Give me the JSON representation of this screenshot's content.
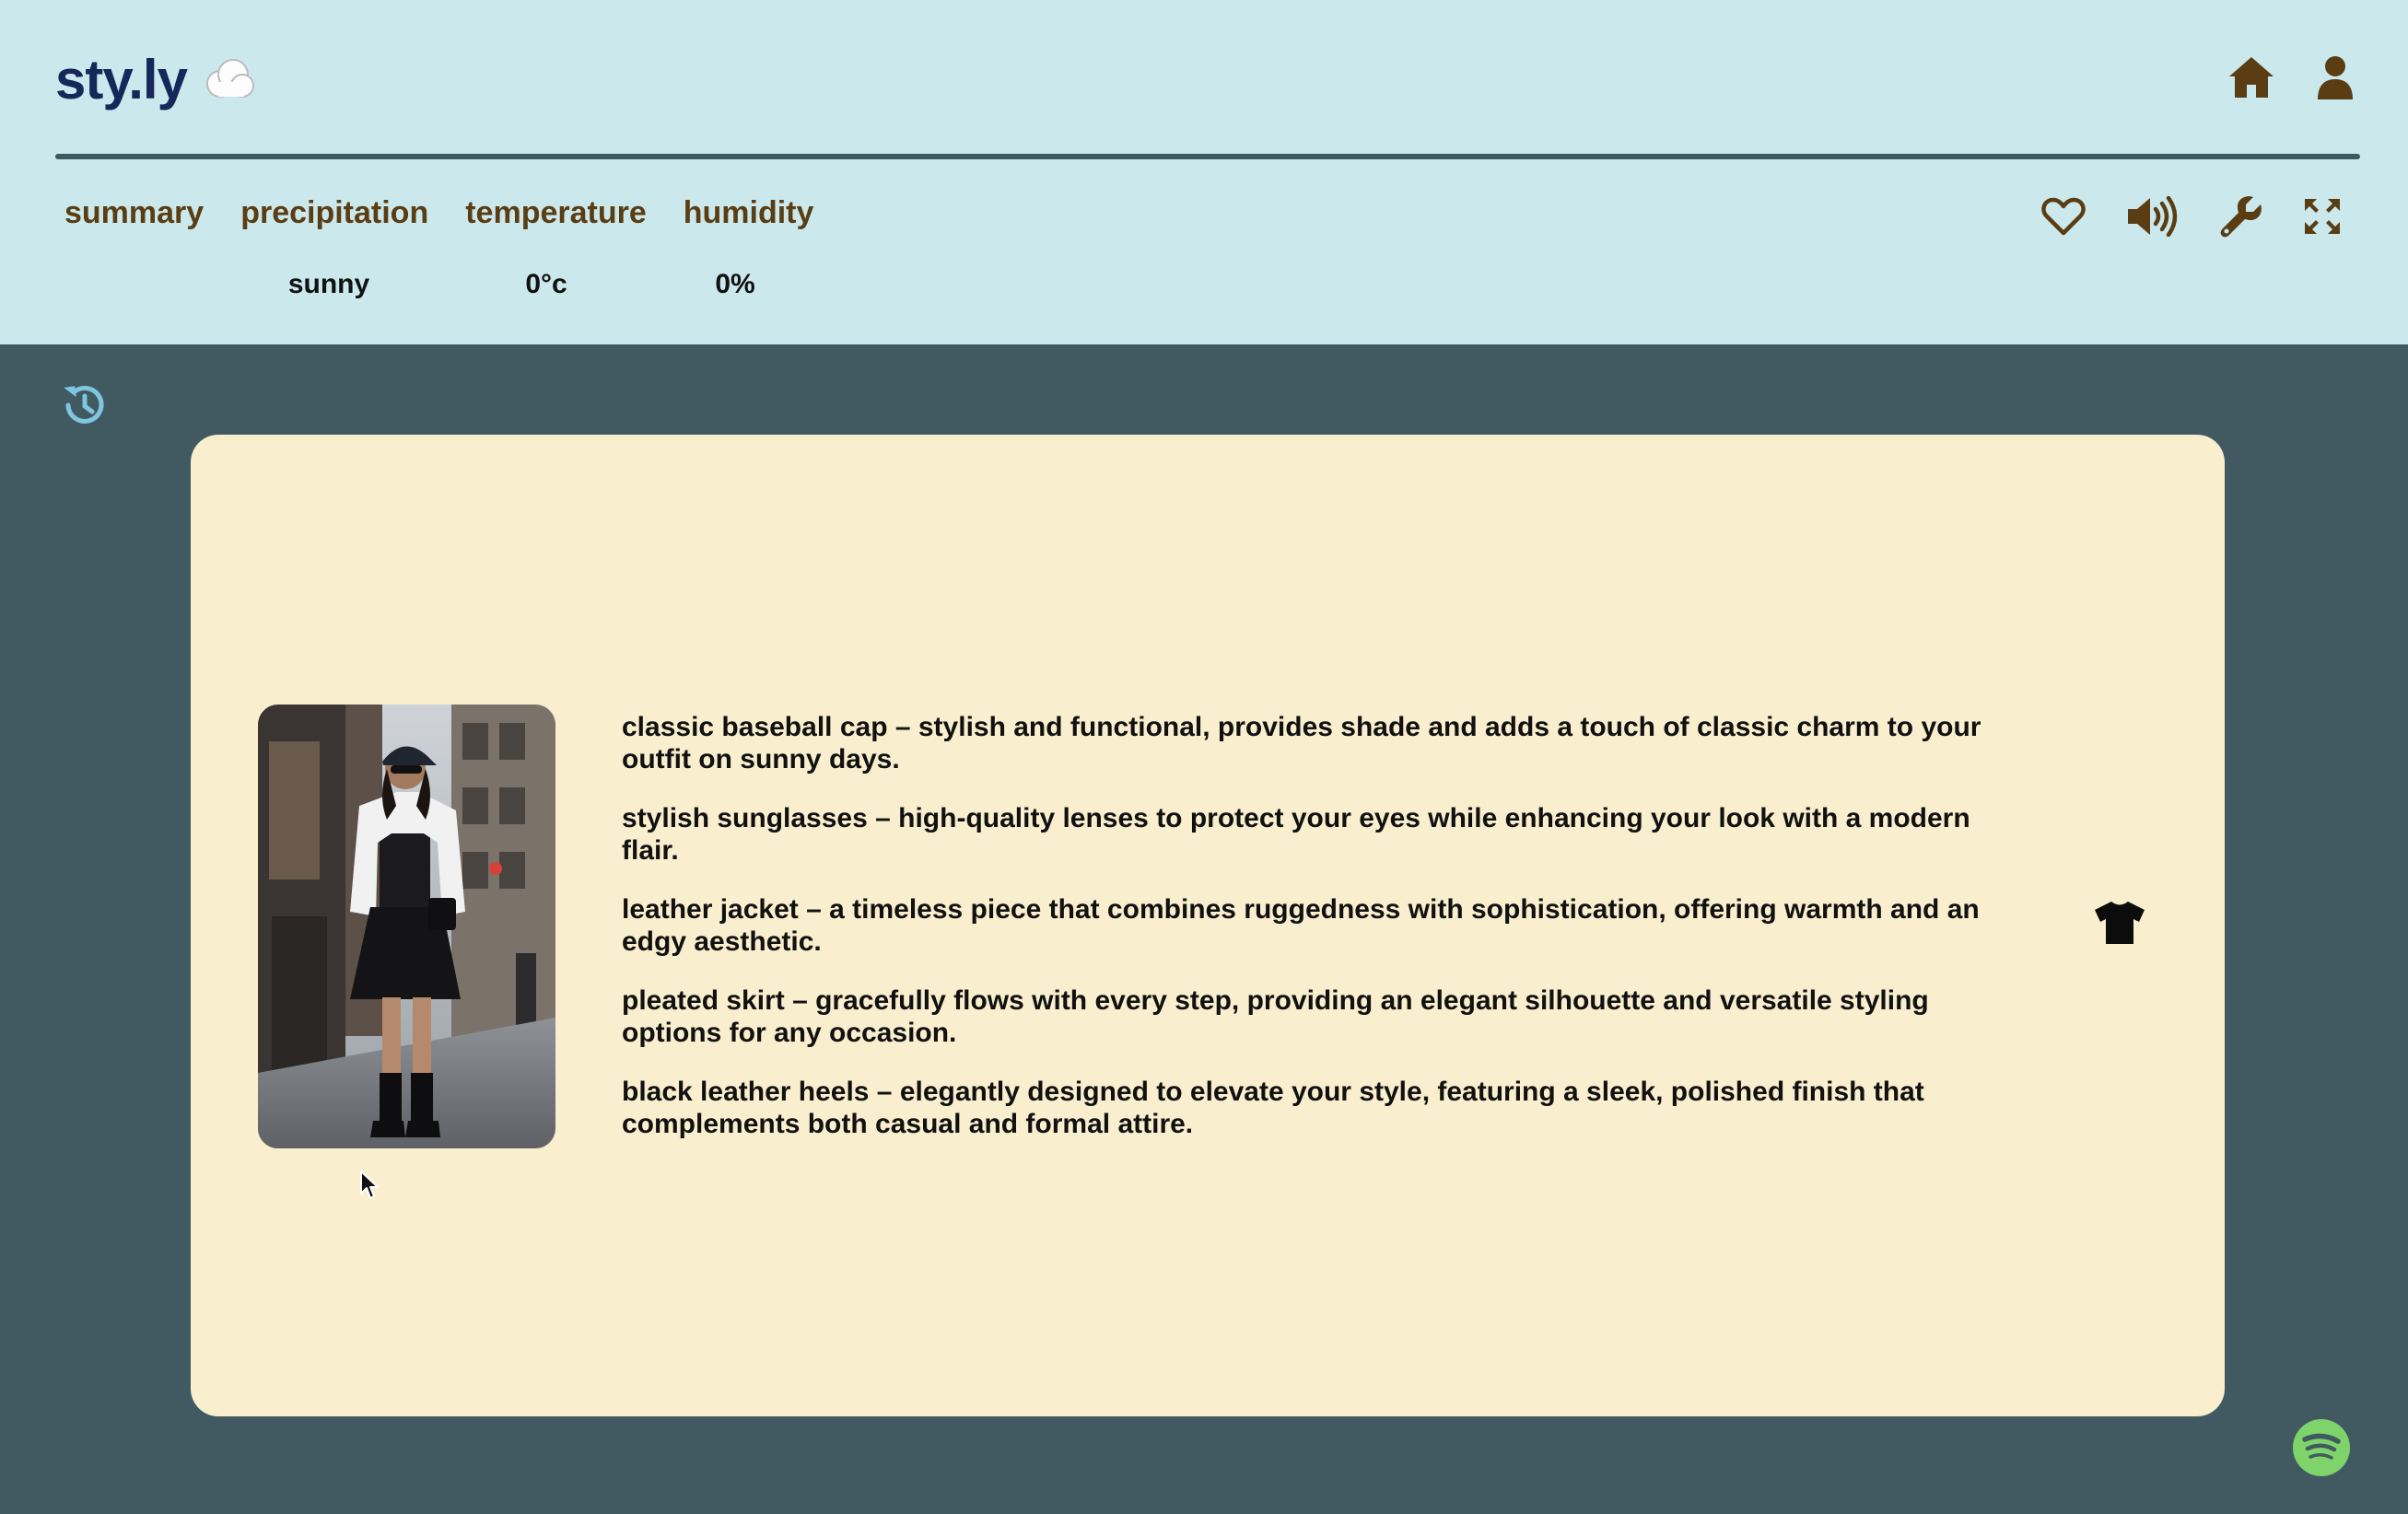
{
  "app": {
    "logo_text": "sty.ly"
  },
  "weather": {
    "tabs": [
      "summary",
      "precipitation",
      "temperature",
      "humidity"
    ],
    "values": {
      "summary": "sunny",
      "temperature": "0°c",
      "humidity": "0%"
    }
  },
  "outfit": {
    "items": [
      "classic baseball cap – stylish and functional, provides shade and adds a touch of classic charm to your outfit on sunny days.",
      "stylish sunglasses – high-quality lenses to protect your eyes while enhancing your look with a modern flair.",
      "leather jacket – a timeless piece that combines ruggedness with sophistication, offering warmth and an edgy aesthetic.",
      "pleated skirt – gracefully flows with every step, providing an elegant silhouette and versatile styling options for any occasion.",
      "black leather heels – elegantly designed to elevate your style, featuring a sleek, polished finish that complements both casual and formal attire."
    ]
  },
  "icons": {
    "header": [
      "cloud-icon",
      "home-icon",
      "user-icon"
    ],
    "tools": [
      "heart-icon",
      "volume-icon",
      "wrench-icon",
      "expand-icon"
    ],
    "other": [
      "history-icon",
      "shirt-icon",
      "spotify-icon",
      "mouse-cursor-icon"
    ]
  },
  "colors": {
    "header_bg": "#cbe9ec",
    "page_bg": "#415a62",
    "card_bg": "#f9eecd",
    "logo": "#16275a",
    "icon_brown": "#5b3d14",
    "history_icon": "#7ec6e0",
    "spotify": "#7ed36a"
  }
}
